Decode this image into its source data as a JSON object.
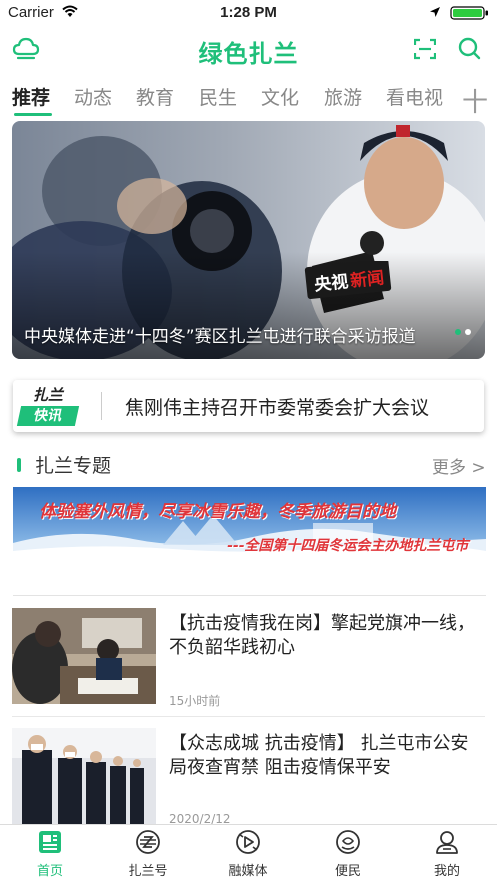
{
  "status_bar": {
    "carrier": "Carrier",
    "time": "1:28 PM"
  },
  "header": {
    "title": "绿色扎兰"
  },
  "tabs": [
    {
      "label": "推荐",
      "active": true
    },
    {
      "label": "动态"
    },
    {
      "label": "教育"
    },
    {
      "label": "民生"
    },
    {
      "label": "文化"
    },
    {
      "label": "旅游"
    },
    {
      "label": "看电视"
    }
  ],
  "tab_add": "十",
  "banner": {
    "caption": "中央媒体走进“十四冬”赛区扎兰屯进行联合采访报道",
    "mic_brand": "央视新闻"
  },
  "flash": {
    "logo_top": "扎兰",
    "logo_bottom": "快讯",
    "text": "焦刚伟主持召开市委常委会扩大会议"
  },
  "section": {
    "title": "扎兰专题",
    "more": "更多 >"
  },
  "topic_banner": {
    "line1": "体验塞外风情，尽享冰雪乐趣，冬季旅游目的地",
    "line2": "---全国第十四届冬运会主办地扎兰屯市"
  },
  "news": [
    {
      "title": "【抗击疫情我在岗】擎起党旗冲一线，不负韶华践初心",
      "time": "15小时前"
    },
    {
      "title": "【众志成城 抗击疫情】 扎兰屯市公安局夜查宵禁 阻击疫情保平安",
      "time": "2020/2/12"
    }
  ],
  "bottom_nav": [
    {
      "label": "首页",
      "icon": "newspaper-icon",
      "active": true
    },
    {
      "label": "扎兰号",
      "icon": "z-badge-icon"
    },
    {
      "label": "融媒体",
      "icon": "media-icon"
    },
    {
      "label": "便民",
      "icon": "service-icon"
    },
    {
      "label": "我的",
      "icon": "user-icon"
    }
  ],
  "colors": {
    "accent": "#1fbf7a",
    "topic_red": "#e0353a"
  }
}
